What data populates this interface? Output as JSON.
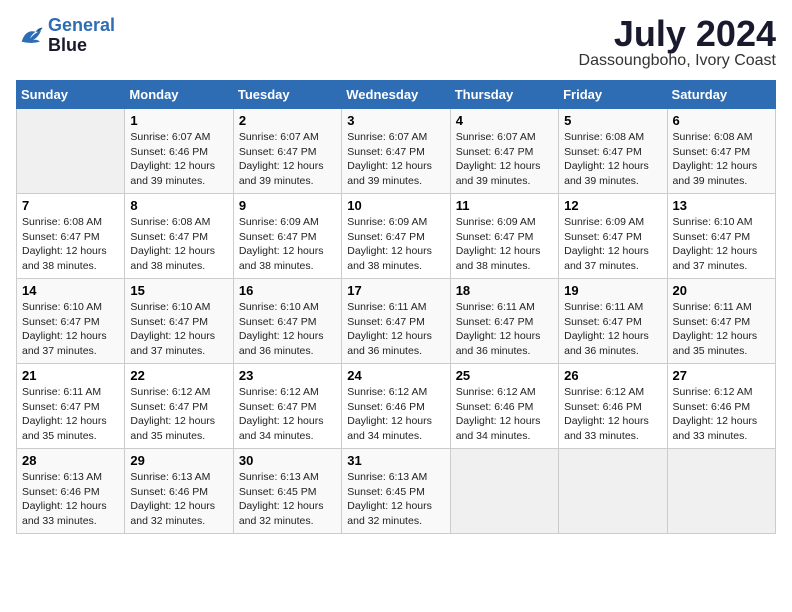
{
  "header": {
    "logo_line1": "General",
    "logo_line2": "Blue",
    "main_title": "July 2024",
    "subtitle": "Dassoungboho, Ivory Coast"
  },
  "days_of_week": [
    "Sunday",
    "Monday",
    "Tuesday",
    "Wednesday",
    "Thursday",
    "Friday",
    "Saturday"
  ],
  "weeks": [
    [
      {
        "day": "",
        "info": ""
      },
      {
        "day": "1",
        "info": "Sunrise: 6:07 AM\nSunset: 6:46 PM\nDaylight: 12 hours\nand 39 minutes."
      },
      {
        "day": "2",
        "info": "Sunrise: 6:07 AM\nSunset: 6:47 PM\nDaylight: 12 hours\nand 39 minutes."
      },
      {
        "day": "3",
        "info": "Sunrise: 6:07 AM\nSunset: 6:47 PM\nDaylight: 12 hours\nand 39 minutes."
      },
      {
        "day": "4",
        "info": "Sunrise: 6:07 AM\nSunset: 6:47 PM\nDaylight: 12 hours\nand 39 minutes."
      },
      {
        "day": "5",
        "info": "Sunrise: 6:08 AM\nSunset: 6:47 PM\nDaylight: 12 hours\nand 39 minutes."
      },
      {
        "day": "6",
        "info": "Sunrise: 6:08 AM\nSunset: 6:47 PM\nDaylight: 12 hours\nand 39 minutes."
      }
    ],
    [
      {
        "day": "7",
        "info": "Sunrise: 6:08 AM\nSunset: 6:47 PM\nDaylight: 12 hours\nand 38 minutes."
      },
      {
        "day": "8",
        "info": "Sunrise: 6:08 AM\nSunset: 6:47 PM\nDaylight: 12 hours\nand 38 minutes."
      },
      {
        "day": "9",
        "info": "Sunrise: 6:09 AM\nSunset: 6:47 PM\nDaylight: 12 hours\nand 38 minutes."
      },
      {
        "day": "10",
        "info": "Sunrise: 6:09 AM\nSunset: 6:47 PM\nDaylight: 12 hours\nand 38 minutes."
      },
      {
        "day": "11",
        "info": "Sunrise: 6:09 AM\nSunset: 6:47 PM\nDaylight: 12 hours\nand 38 minutes."
      },
      {
        "day": "12",
        "info": "Sunrise: 6:09 AM\nSunset: 6:47 PM\nDaylight: 12 hours\nand 37 minutes."
      },
      {
        "day": "13",
        "info": "Sunrise: 6:10 AM\nSunset: 6:47 PM\nDaylight: 12 hours\nand 37 minutes."
      }
    ],
    [
      {
        "day": "14",
        "info": "Sunrise: 6:10 AM\nSunset: 6:47 PM\nDaylight: 12 hours\nand 37 minutes."
      },
      {
        "day": "15",
        "info": "Sunrise: 6:10 AM\nSunset: 6:47 PM\nDaylight: 12 hours\nand 37 minutes."
      },
      {
        "day": "16",
        "info": "Sunrise: 6:10 AM\nSunset: 6:47 PM\nDaylight: 12 hours\nand 36 minutes."
      },
      {
        "day": "17",
        "info": "Sunrise: 6:11 AM\nSunset: 6:47 PM\nDaylight: 12 hours\nand 36 minutes."
      },
      {
        "day": "18",
        "info": "Sunrise: 6:11 AM\nSunset: 6:47 PM\nDaylight: 12 hours\nand 36 minutes."
      },
      {
        "day": "19",
        "info": "Sunrise: 6:11 AM\nSunset: 6:47 PM\nDaylight: 12 hours\nand 36 minutes."
      },
      {
        "day": "20",
        "info": "Sunrise: 6:11 AM\nSunset: 6:47 PM\nDaylight: 12 hours\nand 35 minutes."
      }
    ],
    [
      {
        "day": "21",
        "info": "Sunrise: 6:11 AM\nSunset: 6:47 PM\nDaylight: 12 hours\nand 35 minutes."
      },
      {
        "day": "22",
        "info": "Sunrise: 6:12 AM\nSunset: 6:47 PM\nDaylight: 12 hours\nand 35 minutes."
      },
      {
        "day": "23",
        "info": "Sunrise: 6:12 AM\nSunset: 6:47 PM\nDaylight: 12 hours\nand 34 minutes."
      },
      {
        "day": "24",
        "info": "Sunrise: 6:12 AM\nSunset: 6:46 PM\nDaylight: 12 hours\nand 34 minutes."
      },
      {
        "day": "25",
        "info": "Sunrise: 6:12 AM\nSunset: 6:46 PM\nDaylight: 12 hours\nand 34 minutes."
      },
      {
        "day": "26",
        "info": "Sunrise: 6:12 AM\nSunset: 6:46 PM\nDaylight: 12 hours\nand 33 minutes."
      },
      {
        "day": "27",
        "info": "Sunrise: 6:12 AM\nSunset: 6:46 PM\nDaylight: 12 hours\nand 33 minutes."
      }
    ],
    [
      {
        "day": "28",
        "info": "Sunrise: 6:13 AM\nSunset: 6:46 PM\nDaylight: 12 hours\nand 33 minutes."
      },
      {
        "day": "29",
        "info": "Sunrise: 6:13 AM\nSunset: 6:46 PM\nDaylight: 12 hours\nand 32 minutes."
      },
      {
        "day": "30",
        "info": "Sunrise: 6:13 AM\nSunset: 6:45 PM\nDaylight: 12 hours\nand 32 minutes."
      },
      {
        "day": "31",
        "info": "Sunrise: 6:13 AM\nSunset: 6:45 PM\nDaylight: 12 hours\nand 32 minutes."
      },
      {
        "day": "",
        "info": ""
      },
      {
        "day": "",
        "info": ""
      },
      {
        "day": "",
        "info": ""
      }
    ]
  ]
}
